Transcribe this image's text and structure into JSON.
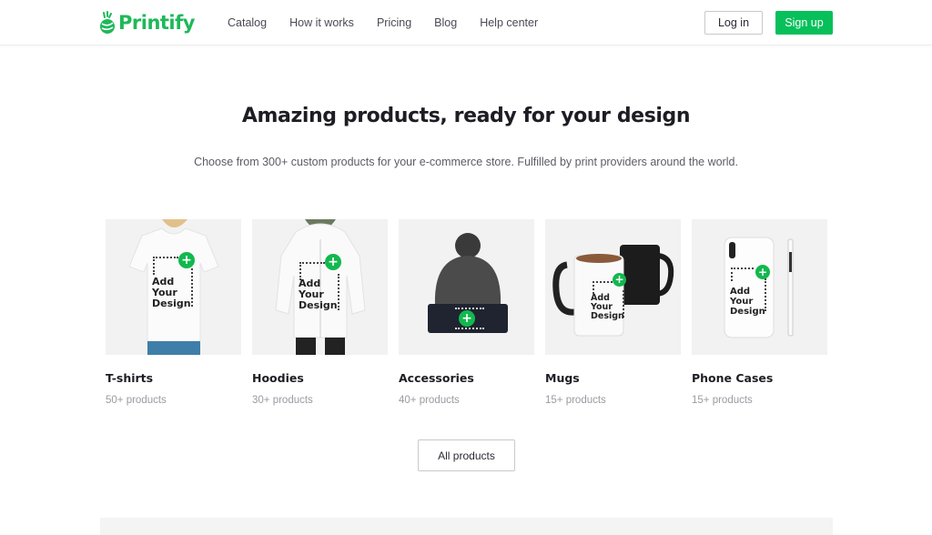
{
  "header": {
    "brand": "Printify",
    "brand_color": "#1fb85a",
    "nav": [
      "Catalog",
      "How it works",
      "Pricing",
      "Blog",
      "Help center"
    ],
    "login_label": "Log in",
    "signup_label": "Sign up",
    "signup_color": "#07c05a"
  },
  "hero": {
    "title": "Amazing products, ready for your design",
    "subtitle": "Choose from 300+ custom products for your e-commerce store. Fulfilled by print providers around the world."
  },
  "products": [
    {
      "title": "T-shirts",
      "count": "50+ products",
      "image": "white t-shirt mockup",
      "overlay": "Add Your Design"
    },
    {
      "title": "Hoodies",
      "count": "30+ products",
      "image": "white zip hoodie mockup",
      "overlay": "Add Your Design"
    },
    {
      "title": "Accessories",
      "count": "40+ products",
      "image": "beanie hat mockup",
      "overlay": ""
    },
    {
      "title": "Mugs",
      "count": "15+ products",
      "image": "white and black mugs mockup",
      "overlay": "Add Your Design"
    },
    {
      "title": "Phone Cases",
      "count": "15+ products",
      "image": "phone case mockup",
      "overlay": "Add Your Design"
    }
  ],
  "overlay_lines": [
    "Add",
    "Your",
    "Design"
  ],
  "all_products_label": "All products"
}
